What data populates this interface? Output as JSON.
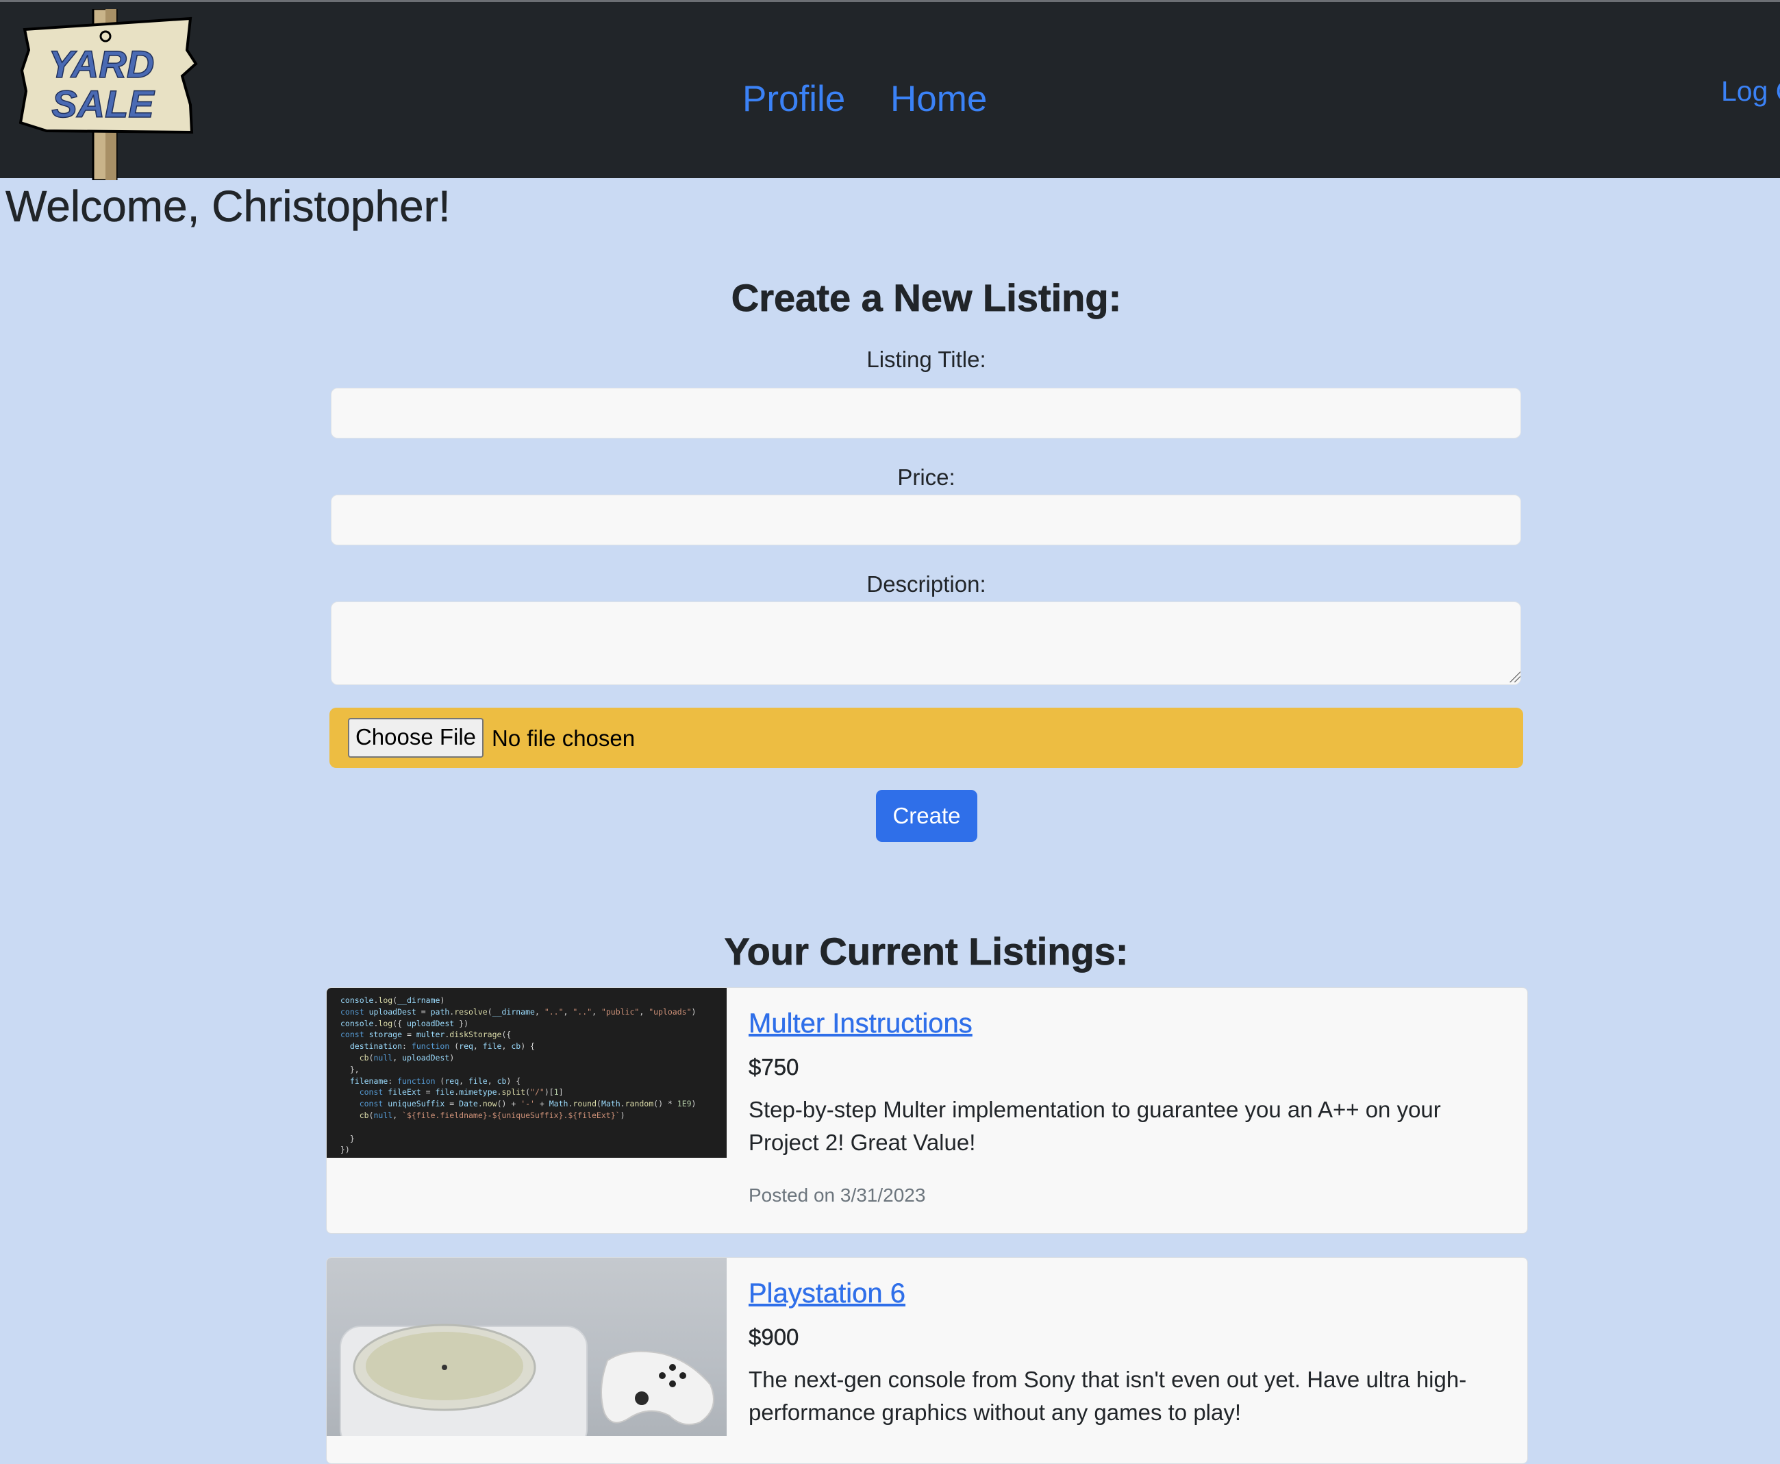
{
  "nav": {
    "logo_line1": "YARD",
    "logo_line2": "SALE",
    "profile": "Profile",
    "home": "Home",
    "logout": "Log Out"
  },
  "welcome": "Welcome, Christopher!",
  "create_form": {
    "title": "Create a New Listing:",
    "listing_title_label": "Listing Title:",
    "listing_title_value": "",
    "price_label": "Price:",
    "price_value": "",
    "description_label": "Description:",
    "description_value": "",
    "choose_file": "Choose File",
    "file_status": "No file chosen",
    "submit": "Create"
  },
  "listings": {
    "title": "Your Current Listings:",
    "items": [
      {
        "title": "Multer Instructions",
        "price": "$750",
        "description": "Step-by-step Multer implementation to guarantee you an A++ on your Project 2! Great Value!",
        "posted": "Posted on 3/31/2023"
      },
      {
        "title": "Playstation 6",
        "price": "$900",
        "description": "The next-gen console from Sony that isn't even out yet. Have ultra high-performance graphics without any games to play!"
      }
    ]
  },
  "colors": {
    "navbar": "#212529",
    "link": "#3b82f6",
    "page_bg": "#cadaf3",
    "file_bar": "#edbd42",
    "button": "#2f6fe9"
  }
}
